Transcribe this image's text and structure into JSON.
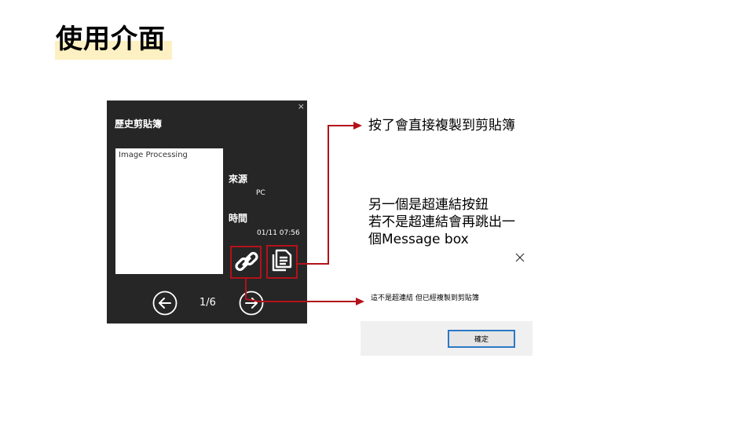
{
  "slide": {
    "title": "使用介面"
  },
  "app": {
    "close_glyph": "×",
    "title": "歷史剪貼簿",
    "preview_text": "Image Processing",
    "source_label": "來源",
    "source_value": "PC",
    "time_label": "時間",
    "time_value": "01/11 07:56",
    "pager": "1/6",
    "icons": [
      "link-icon",
      "copy-icon",
      "arrow-left-icon",
      "arrow-right-icon"
    ]
  },
  "annotations": {
    "copy_note": "按了會直接複製到剪貼簿",
    "link_note_lines": [
      "另一個是超連結按鈕",
      "若不是超連結會再跳出一",
      "個Message box"
    ]
  },
  "message_box": {
    "text": "這不是超連結 但已經複製到剪貼簿",
    "ok_label": "確定"
  },
  "colors": {
    "app_bg": "#262626",
    "highlight": "#fdf0c2",
    "callout": "#b3121a",
    "ok_border": "#2b78c6"
  }
}
